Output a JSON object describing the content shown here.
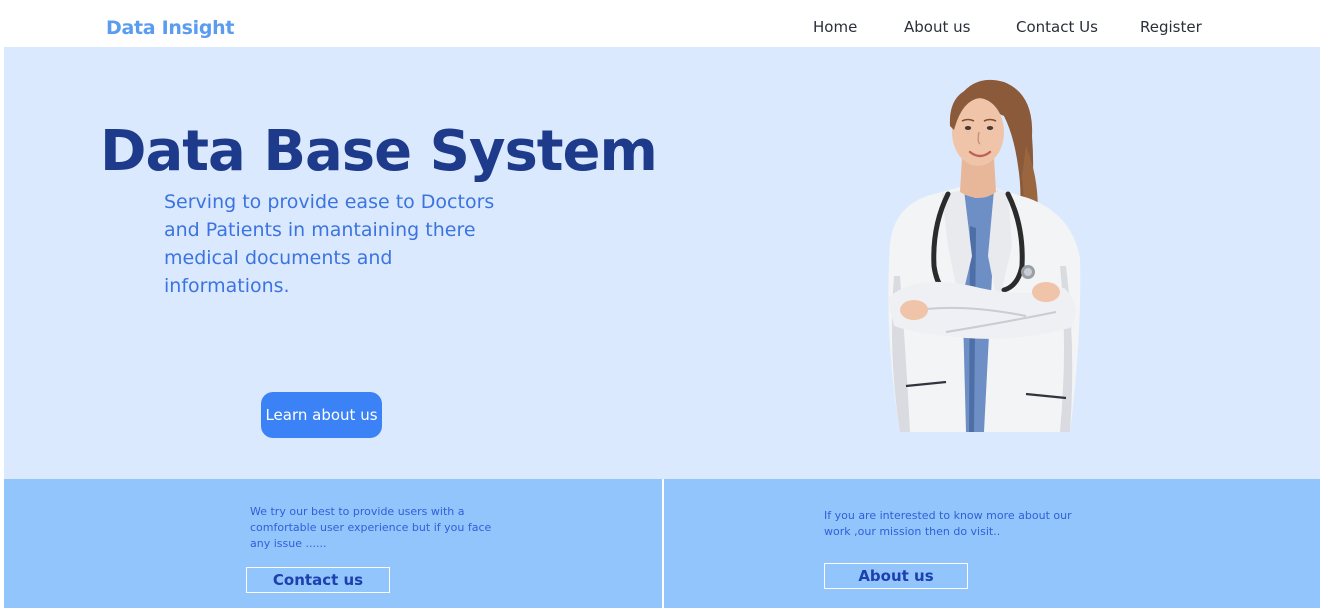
{
  "navbar": {
    "brand": "Data Insight",
    "links": {
      "home": "Home",
      "about": "About us",
      "contact": "Contact Us",
      "register": "Register"
    }
  },
  "hero": {
    "title": "Data Base System",
    "subtitle": "Serving to provide ease to Doctors and Patients in mantaining there medical documents and informations.",
    "button_label": "Learn about us",
    "image": "doctor-photo"
  },
  "panels": {
    "contact": {
      "text": "We try our best to provide users with a comfortable user experience but if you face any issue ......",
      "button_label": "Contact us"
    },
    "about": {
      "text": "If you are interested to know more about our work ,our mission then do visit..",
      "button_label": "About us"
    }
  },
  "colors": {
    "brand": "#5b9cf0",
    "hero_background": "#dbe9fe",
    "title": "#1e3a8a",
    "subtitle": "#3b74e0",
    "primary_button": "#3b82f6",
    "panel_background": "#93c5fd",
    "panel_button_text": "#1e40af"
  }
}
